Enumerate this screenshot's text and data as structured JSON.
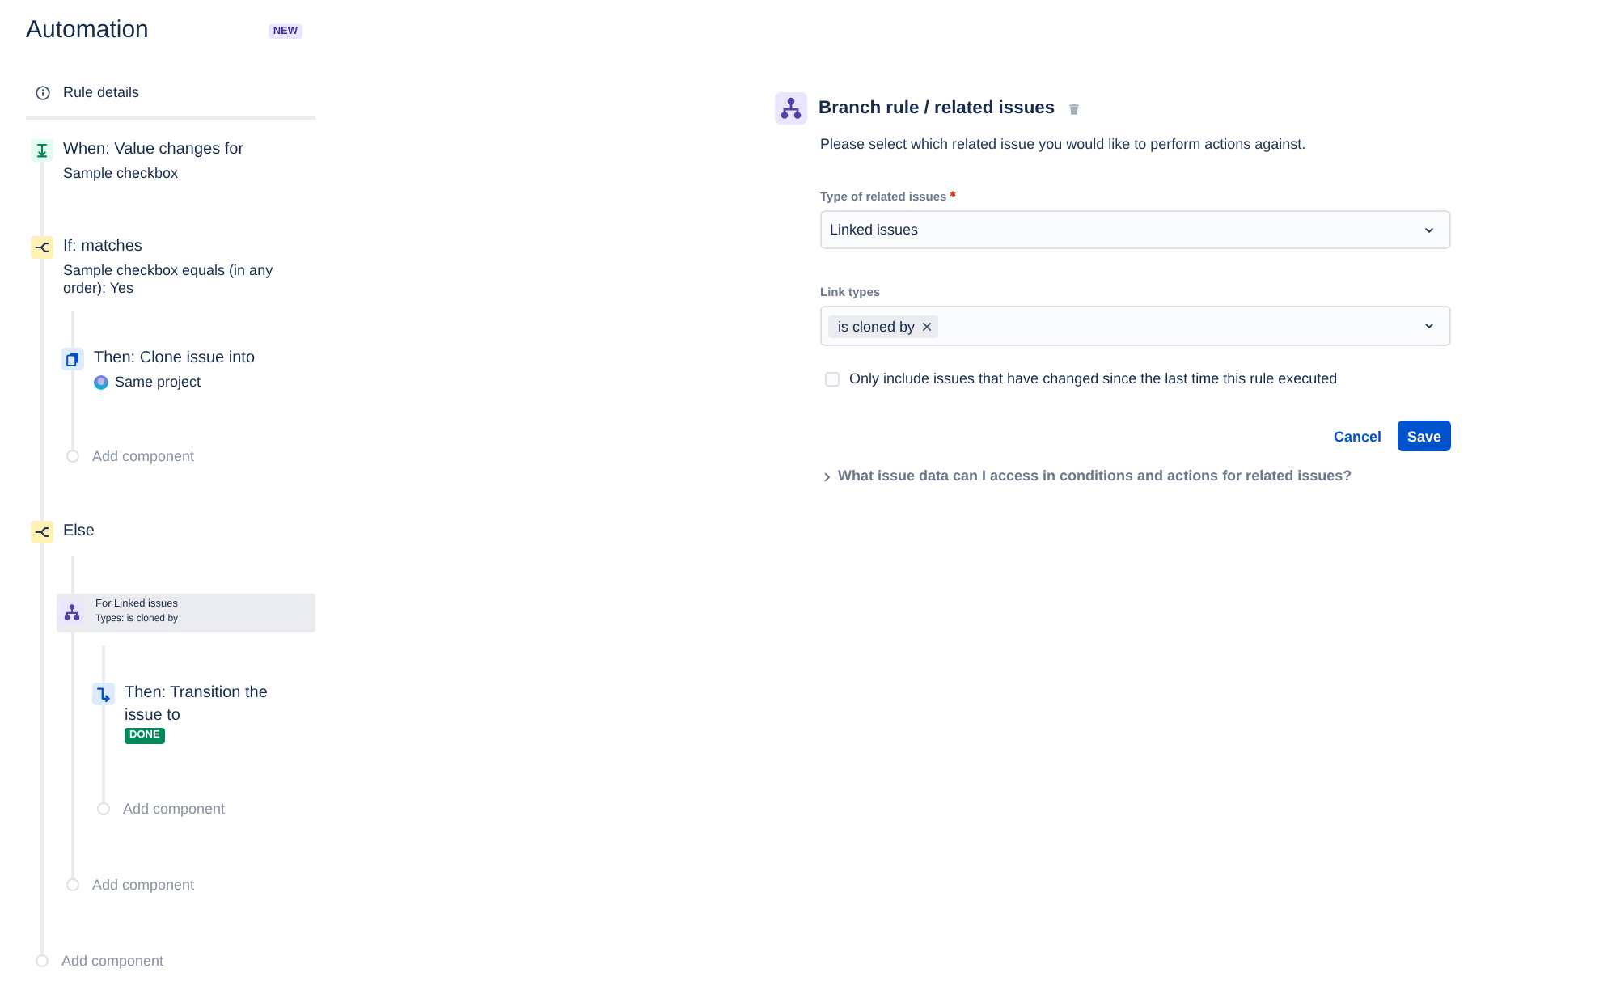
{
  "sidebar": {
    "title": "Automation",
    "badge": "NEW",
    "rule_details": "Rule details",
    "components": [
      {
        "kind": "trigger",
        "title": "When: Value changes for",
        "detail": "Sample checkbox",
        "selected": false
      },
      {
        "kind": "condition",
        "title": "If: matches",
        "detail": "Sample checkbox equals (in any order): Yes",
        "selected": false,
        "children": [
          {
            "kind": "clone",
            "title": "Then: Clone issue into",
            "detail": "Same project",
            "selected": false
          }
        ],
        "add_label": "Add component"
      },
      {
        "kind": "condition",
        "title": "Else",
        "selected": false,
        "children": [
          {
            "kind": "branch",
            "title": "For Linked issues",
            "detail": "Types: is cloned by",
            "selected": true,
            "children": [
              {
                "kind": "transition",
                "title": "Then: Transition the issue to",
                "status": "DONE",
                "selected": false
              }
            ],
            "add_label": "Add component"
          }
        ],
        "add_label": "Add component"
      }
    ],
    "add_label": "Add component"
  },
  "panel": {
    "title": "Branch rule / related issues",
    "description": "Please select which related issue you would like to perform actions against.",
    "fields": [
      {
        "kind": "select",
        "label": "Type of related issues",
        "required": true,
        "value": "Linked issues"
      },
      {
        "kind": "multiselect",
        "label": "Link types",
        "required": false,
        "tags": [
          "is cloned by"
        ]
      }
    ],
    "checkbox": {
      "label": "Only include issues that have changed since the last time this rule executed",
      "checked": false
    },
    "buttons": [
      {
        "kind": "subtle",
        "label": "Cancel"
      },
      {
        "kind": "primary",
        "label": "Save"
      }
    ],
    "expander": {
      "label": "What issue data can I access in conditions and actions for related issues?",
      "expanded": false
    }
  }
}
